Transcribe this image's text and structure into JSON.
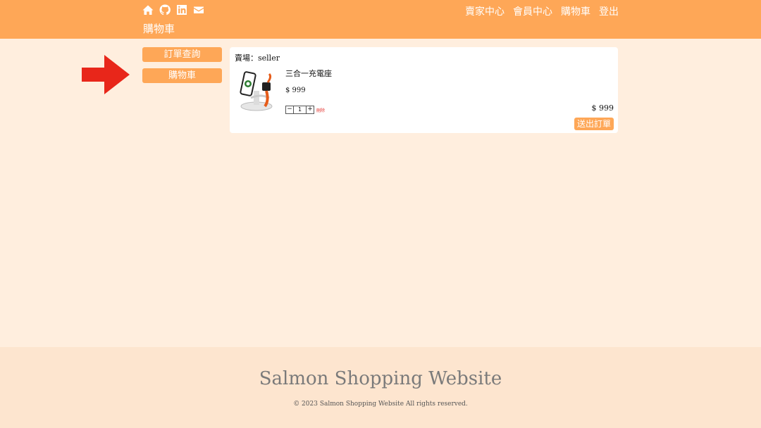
{
  "header": {
    "icons": [
      "home-icon",
      "github-icon",
      "linkedin-icon",
      "mail-icon"
    ],
    "nav": [
      "賣家中心",
      "會員中心",
      "購物車",
      "登出"
    ],
    "page_title": "購物車"
  },
  "sidebar": {
    "items": [
      {
        "label": "訂單查詢"
      },
      {
        "label": "購物車"
      }
    ]
  },
  "cart": {
    "seller_label": "賣場：seller",
    "item": {
      "name": "三合一充電座",
      "price": "$ 999",
      "quantity": "1",
      "minus": "−",
      "plus": "+",
      "delete_label": "刪除"
    },
    "total": "$  999",
    "submit_label": "送出訂單"
  },
  "footer": {
    "brand": "Salmon Shopping Website",
    "copyright": "© 2023 Salmon Shopping Website All rights reserved."
  },
  "colors": {
    "accent": "#fea757",
    "background": "#ffeede",
    "footer": "#fde5cf",
    "arrow": "#e8261a"
  }
}
